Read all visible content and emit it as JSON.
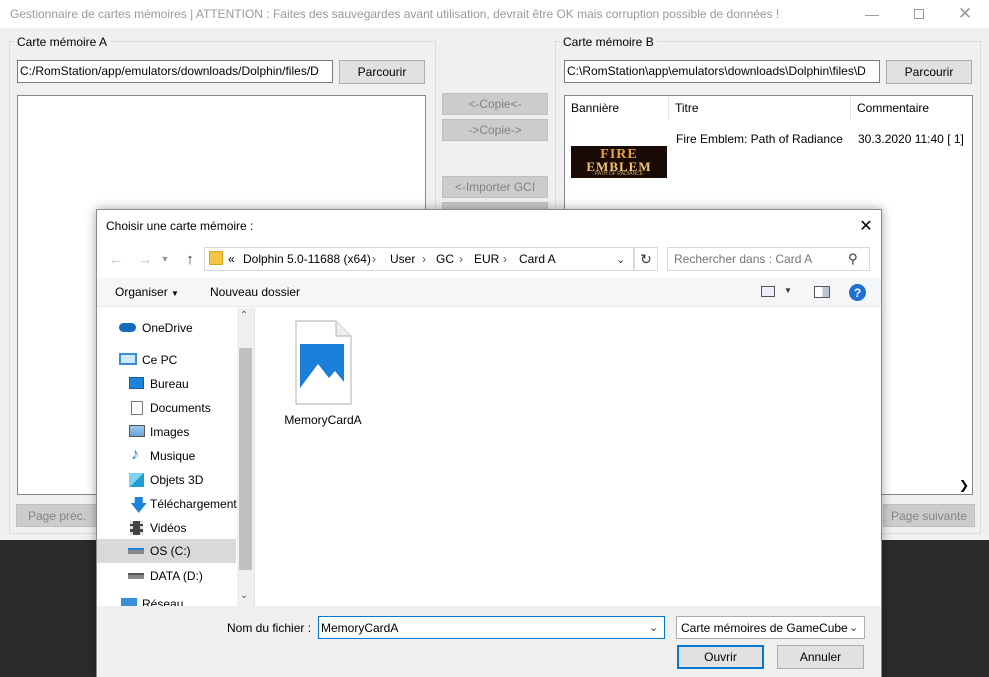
{
  "main_window": {
    "title": "Gestionnaire de cartes mémoires | ATTENTION : Faites des sauvegardes avant utilisation, devrait être OK mais corruption possible de données !",
    "card_a": {
      "label": "Carte mémoire A",
      "path": "C:/RomStation/app/emulators/downloads/Dolphin/files/D",
      "browse": "Parcourir",
      "prev_page": "Page préc."
    },
    "card_b": {
      "label": "Carte mémoire B",
      "path": "C:\\RomStation\\app\\emulators\\downloads\\Dolphin\\files\\D",
      "browse": "Parcourir",
      "next_page": "Page suivante",
      "columns": [
        "Bannière",
        "Titre",
        "Commentaire"
      ],
      "rows": [
        {
          "banner": [
            "FIRE",
            "EMBLEM",
            "PATH OF RADIANCE"
          ],
          "title": "Fire Emblem: Path of Radiance",
          "comment": "30.3.2020 11:40 [ 1]"
        }
      ]
    },
    "middle_buttons": {
      "copy_left": "<-Copie<-",
      "copy_right": "->Copie->",
      "import_gci": "<-Importer GCI"
    }
  },
  "dialog": {
    "title": "Choisir une carte mémoire :",
    "breadcrumb": {
      "overflow": "«",
      "segments": [
        "Dolphin 5.0-11688 (x64)",
        "User",
        "GC",
        "EUR",
        "Card A"
      ]
    },
    "search_placeholder": "Rechercher dans : Card A",
    "toolbar": {
      "organize": "Organiser",
      "new_folder": "Nouveau dossier"
    },
    "nav_items": [
      {
        "label": "OneDrive",
        "icon": "cloud-icon"
      },
      {
        "label": "Ce PC",
        "icon": "computer-icon"
      },
      {
        "label": "Bureau",
        "icon": "desktop-icon"
      },
      {
        "label": "Documents",
        "icon": "documents-icon"
      },
      {
        "label": "Images",
        "icon": "pictures-icon"
      },
      {
        "label": "Musique",
        "icon": "music-icon"
      },
      {
        "label": "Objets 3D",
        "icon": "objects-3d-icon"
      },
      {
        "label": "Téléchargements",
        "icon": "downloads-icon"
      },
      {
        "label": "Vidéos",
        "icon": "videos-icon"
      },
      {
        "label": "OS (C:)",
        "icon": "drive-c-icon"
      },
      {
        "label": "DATA (D:)",
        "icon": "drive-d-icon"
      },
      {
        "label": "Réseau",
        "icon": "network-icon"
      }
    ],
    "files": [
      {
        "name": "MemoryCardA",
        "icon": "image-file-icon"
      }
    ],
    "filename_label": "Nom du fichier :",
    "filename_value": "MemoryCardA",
    "filetype": "Carte mémoires de GameCube",
    "open": "Ouvrir",
    "cancel": "Annuler"
  },
  "colors": {
    "accent": "#0078d7",
    "selection": "#d9d9d9",
    "disabled_text": "#838383"
  }
}
